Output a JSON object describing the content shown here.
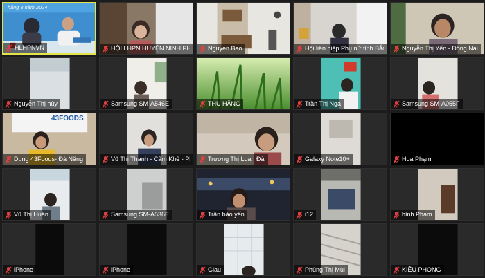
{
  "meeting": {
    "participants": [
      {
        "name": "HLHPNVN",
        "muted": true,
        "active": true,
        "banner": "hăng 3 năm 2024"
      },
      {
        "name": "HỘI LHPN HUYỆN NINH PH...",
        "muted": true
      },
      {
        "name": "Nguyen Bao",
        "muted": true
      },
      {
        "name": "Hội liên hiệp Phụ nữ tỉnh Bắc...",
        "muted": true
      },
      {
        "name": "Nguyễn Thị Yến - Đồng Nai",
        "muted": true
      },
      {
        "name": "Nguyễn Thị hủy",
        "muted": true
      },
      {
        "name": "Samsung SM-A546E",
        "muted": true
      },
      {
        "name": "THU HẰNG",
        "muted": true
      },
      {
        "name": "Trần Thị Nga",
        "muted": true
      },
      {
        "name": "Samsung SM-A055F",
        "muted": true
      },
      {
        "name": "Dung 43Foods- Đà Nẵng",
        "muted": true,
        "sign": "43FOODS"
      },
      {
        "name": "Vũ Thị Thanh - Cẩm Khê - Ph...",
        "muted": true
      },
      {
        "name": "Trương Thị Loan Đài",
        "muted": true
      },
      {
        "name": "Galaxy Note10+",
        "muted": true
      },
      {
        "name": "Hoa Phạm",
        "muted": true
      },
      {
        "name": "Vũ Thị Huân",
        "muted": true
      },
      {
        "name": "Samsung SM-A536E",
        "muted": true
      },
      {
        "name": "Trần bảo yến",
        "muted": true
      },
      {
        "name": "i12",
        "muted": true
      },
      {
        "name": "bình Phạm",
        "muted": true
      },
      {
        "name": "iPhone",
        "muted": true
      },
      {
        "name": "iPhone",
        "muted": true
      },
      {
        "name": "Giau",
        "muted": true
      },
      {
        "name": "Phùng Thị Mùi",
        "muted": true
      },
      {
        "name": "KIỀU PHONG",
        "muted": true
      }
    ]
  },
  "colors": {
    "active_border": "#e3e34a",
    "muted_mic": "#e04040",
    "tile_bg": "#2a2a2a"
  }
}
